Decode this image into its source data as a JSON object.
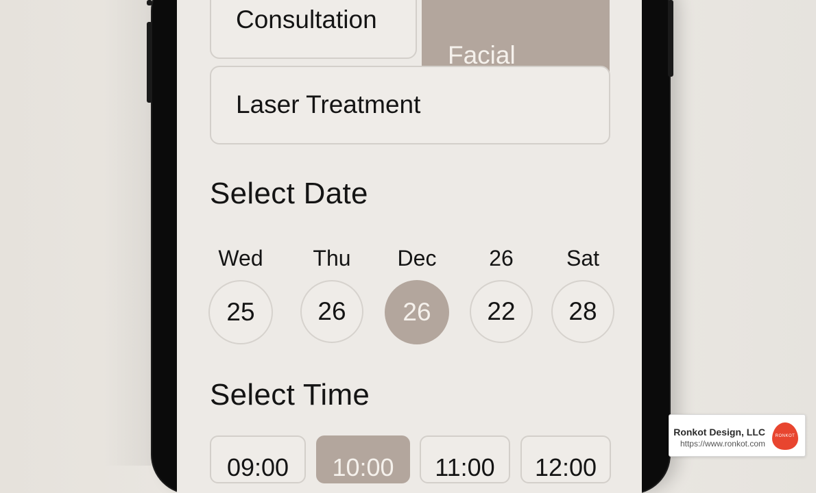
{
  "services": [
    {
      "label": "Consultation",
      "selected": false
    },
    {
      "label": "Facial\nTreatment",
      "selected": true
    },
    {
      "label": "Laser Treatment",
      "selected": false
    }
  ],
  "date_section": {
    "title": "Select Date",
    "days": [
      {
        "label": "Wed",
        "number": "25",
        "selected": false
      },
      {
        "label": "Thu",
        "number": "26",
        "selected": false
      },
      {
        "label": "Dec",
        "number": "26",
        "selected": true
      },
      {
        "label": "26",
        "number": "22",
        "selected": false
      },
      {
        "label": "Sat",
        "number": "28",
        "selected": false
      }
    ]
  },
  "time_section": {
    "title": "Select Time",
    "slots": [
      {
        "label": "09:00",
        "selected": false
      },
      {
        "label": "10:00",
        "selected": true
      },
      {
        "label": "11:00",
        "selected": false
      },
      {
        "label": "12:00",
        "selected": false
      }
    ]
  },
  "badge": {
    "company": "Ronkot Design, LLC",
    "url": "https://www.ronkot.com",
    "logo_text": "RONKOT"
  },
  "colors": {
    "accent": "#b3a69d",
    "screen_bg": "#edeae6",
    "logo_red": "#e8452f"
  }
}
